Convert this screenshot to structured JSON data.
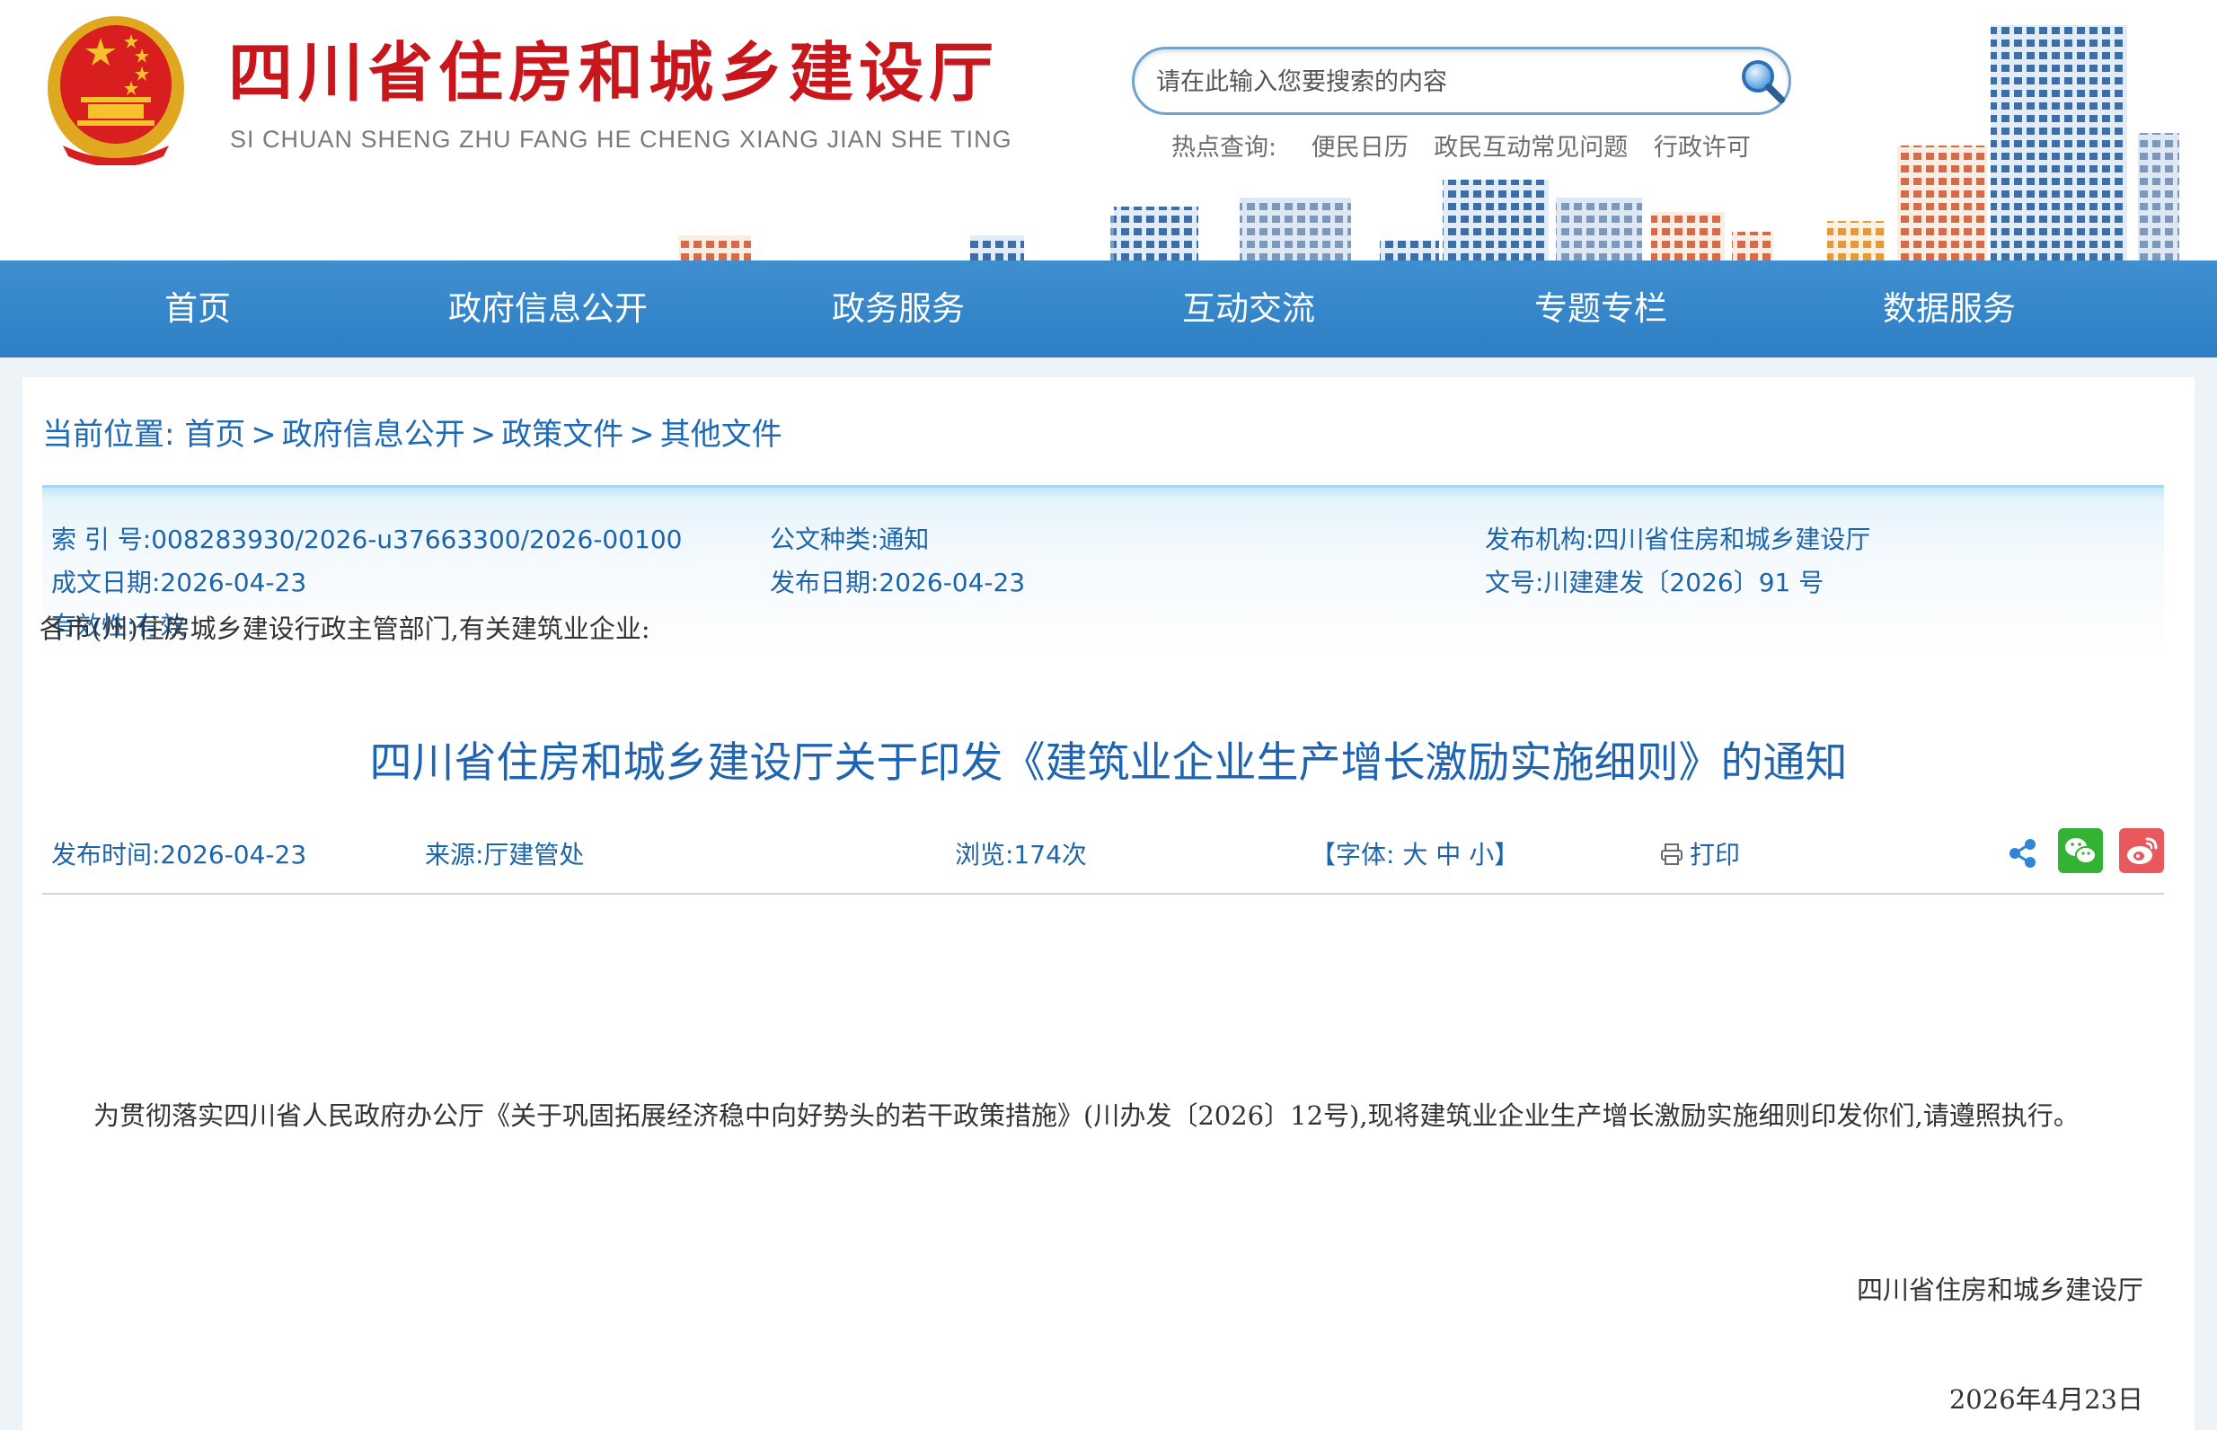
{
  "header": {
    "title": "四川省住房和城乡建设厅",
    "pinyin": "SI CHUAN SHENG ZHU FANG HE CHENG XIANG JIAN SHE TING",
    "search_placeholder": "请在此输入您要搜索的内容",
    "hot_label": "热点查询:",
    "hot_links": [
      "便民日历",
      "政民互动常见问题",
      "行政许可"
    ]
  },
  "nav": [
    "首页",
    "政府信息公开",
    "政务服务",
    "互动交流",
    "专题专栏",
    "数据服务"
  ],
  "breadcrumb": {
    "label": "当前位置:",
    "items": [
      "首页",
      "政府信息公开",
      "政策文件",
      "其他文件"
    ],
    "separator": ">"
  },
  "meta": {
    "index_no": "索 引 号:008283930/2026-u37663300/2026-00100",
    "category": "公文种类:通知",
    "publisher": "发布机构:四川省住房和城乡建设厅",
    "doc_date": "成文日期:2026-04-23",
    "pub_date": "发布日期:2026-04-23",
    "doc_no": "文号:川建建发〔2026〕91 号",
    "validity": "有效性:有效"
  },
  "article": {
    "title": "四川省住房和城乡建设厅关于印发《建筑业企业生产增长激励实施细则》的通知",
    "publish_time": "发布时间:2026-04-23",
    "source": "来源:厅建管处",
    "views": "浏览:174次",
    "font_label_open": "【字体:",
    "font_large": "大",
    "font_medium": "中",
    "font_small": "小",
    "font_label_close": "】",
    "print": "打印",
    "greeting": "各市(州)住房城乡建设行政主管部门,有关建筑业企业:",
    "paragraph": "为贯彻落实四川省人民政府办公厅《关于巩固拓展经济稳中向好势头的若干政策措施》(川办发〔2026〕12号),现将建筑业企业生产增长激励实施细则印发你们,请遵照执行。",
    "signature": "四川省住房和城乡建设厅",
    "date": "2026年4月23日"
  },
  "colors": {
    "brand_red": "#c8161d",
    "nav_blue": "#3a8bce",
    "link_blue": "#1e64a8"
  },
  "icons": [
    "national-emblem",
    "search-icon",
    "printer-icon",
    "share-icon",
    "wechat-icon",
    "weibo-icon"
  ]
}
